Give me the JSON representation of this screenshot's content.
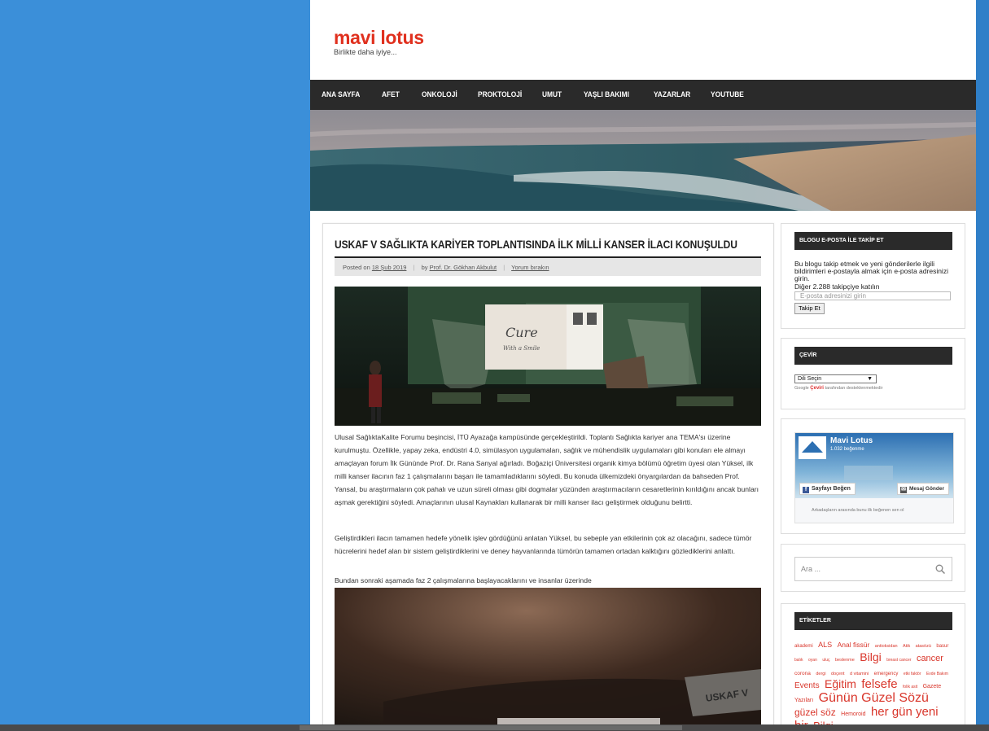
{
  "site": {
    "title": "mavi lotus",
    "description": "Birlikte daha iyiye..."
  },
  "nav": {
    "items": [
      "ANA SAYFA",
      "AFET",
      "ONKOLOJİ",
      "PROKTOLOJİ",
      "UMUT",
      "YAŞLI BAKIMI",
      "YAZARLAR",
      "YOUTUBE"
    ]
  },
  "post": {
    "title": "USKAF V SAĞLIKTA KARİYER TOPLANTISINDA İLK MİLLİ KANSER İLACI KONUŞULDU",
    "posted_on": "Posted on",
    "date": "18 Şub 2019",
    "by": "by",
    "author": "Prof. Dr. Gökhan Akbulut",
    "comment": "Yorum bırakın",
    "image_text_1": "Cure",
    "image_text_2": "With a Smile",
    "paragraphs": [
      "Ulusal SağlıktaKalite Forumu beşincisi, İTÜ Ayazağa kampüsünde gerçekleştirildi. Toplantı Sağlıkta kariyer ana TEMA'sı üzerine kurulmuştu. Özellikle, yapay zeka, endüstri 4.0, simülasyon uygulamaları, sağlık ve mühendislik uygulamaları gibi konuları ele almayı amaçlayan forum İlk Gününde Prof. Dr. Rana Sanyal ağırladı. Boğaziçi Üniversitesi organik kimya bölümü öğretim üyesi olan Yüksel, ilk milli kanser ilacının faz 1 çalışmalarını başarı ile tamamladıklarını söyledi. Bu konuda ülkemizdeki önyargılardan da bahseden Prof. Yansal, bu araştırmaların çok pahalı ve uzun süreli olması gibi dogmalar yüzünden araştırmacıların cesaretlerinin kırıldığını ancak bunları aşmak gerektiğini söyledi. Amaçlarının ulusal Kaynakları kullanarak bir milli kanser ilacı geliştirmek olduğunu belirtti.",
      "Geliştirdikleri ilacın tamamen hedefe yönelik işlev gördüğünü anlatan Yüksel, bu sebeple yan etkilerinin çok az olacağını, sadece tümör hücrelerini hedef alan bir sistem geliştirdiklerini ve deney hayvanlarında tümörün tamamen ortadan kalktığını gözlediklerini anlattı.",
      "Bundan sonraki aşamada faz 2 çalışmalarına başlayacaklarını ve insanlar üzerinde"
    ],
    "image2_text": "USKAF V"
  },
  "sidebar": {
    "email_widget": {
      "title": "BLOGU E-POSTA İLE TAKİP ET",
      "text": "Bu blogu takip etmek ve yeni gönderilerle ilgili bildirimleri e-postayla almak için e-posta adresinizi girin.",
      "followers": "Diğer 2.288 takipçiye katılın",
      "placeholder": "E-posta adresinizi girin",
      "button": "Takip Et"
    },
    "translate_widget": {
      "title": "ÇEVİR",
      "select": "Dili Seçin",
      "powered_google": "Google",
      "powered_ceviri": "Çeviri",
      "powered_rest": "tarafından desteklenmektedir"
    },
    "facebook_widget": {
      "page_name": "Mavi Lotus",
      "likes": "1.032 beğenme",
      "like_button": "Sayfayı Beğen",
      "message_button": "Mesaj Gönder",
      "friends_text": "Arkadaşların arasında bunu ilk beğenen sen ol"
    },
    "search": {
      "placeholder": "Ara ..."
    },
    "tags_widget": {
      "title": "ETİKETLER",
      "tags": [
        {
          "t": "akademi",
          "s": 6
        },
        {
          "t": "ALS",
          "s": 9
        },
        {
          "t": "Anal fissür",
          "s": 8.5
        },
        {
          "t": "antioksidan",
          "s": 5.5
        },
        {
          "t": "Atik",
          "s": 5.5
        },
        {
          "t": "atasözü",
          "s": 5.5
        },
        {
          "t": "basur",
          "s": 6
        },
        {
          "t": "balık",
          "s": 5
        },
        {
          "t": "oyan",
          "s": 5
        },
        {
          "t": "uluç",
          "s": 5
        },
        {
          "t": "beslenme",
          "s": 5.5
        },
        {
          "t": "Bilgi",
          "s": 14
        },
        {
          "t": "breast cancer",
          "s": 5
        },
        {
          "t": "cancer",
          "s": 11
        },
        {
          "t": "corona",
          "s": 6.5
        },
        {
          "t": "dergi",
          "s": 5.5
        },
        {
          "t": "doçent",
          "s": 5.5
        },
        {
          "t": "d vitamini",
          "s": 5.5
        },
        {
          "t": "emergency",
          "s": 6
        },
        {
          "t": "etki faktör",
          "s": 5
        },
        {
          "t": "Evde Bakım",
          "s": 5
        },
        {
          "t": "Events",
          "s": 10
        },
        {
          "t": "Eğitim",
          "s": 14
        },
        {
          "t": "felsefe",
          "s": 15
        },
        {
          "t": "folik asit",
          "s": 5
        },
        {
          "t": "Gazete Yazıları",
          "s": 7
        },
        {
          "t": "Günün Güzel Sözü",
          "s": 16
        },
        {
          "t": "güzel söz",
          "s": 12
        },
        {
          "t": "Hemoroid",
          "s": 7
        },
        {
          "t": "her gün yeni bir",
          "s": 15
        },
        {
          "t": "Bilgi",
          "s": 13
        }
      ]
    }
  }
}
